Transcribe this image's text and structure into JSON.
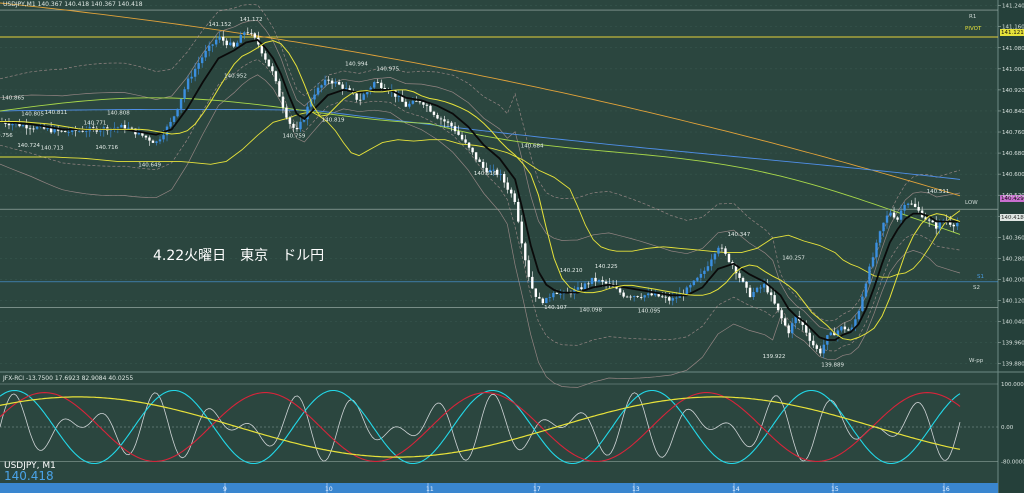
{
  "window": {
    "title": "USDJPY,M1 140.367 140.418 140.367 140.418",
    "caption": "4.22火曜日　東京　ドル円",
    "overlay_symbol": "USDJPY, M1",
    "overlay_price": "140.418"
  },
  "colors": {
    "background": "#2b463f",
    "grid": "#3b5a52",
    "candle_up": "#3b8fe0",
    "candle_down": "#ffffff",
    "ma_black": "#0a0a0a",
    "ma_yellow": "#e6e23a",
    "ma_green": "#a8d84a",
    "ma_blue": "#4f8fe8",
    "ma_orange": "#e2a33a",
    "bollinger": "#b79a9a",
    "osc_red": "#d8243a",
    "osc_cyan": "#22d8e8",
    "osc_white": "#cfd4d6",
    "osc_yellow": "#e8e23a"
  },
  "chart_data": {
    "type": "line",
    "symbol": "USDJPY",
    "timeframe": "M1",
    "ylim": [
      139.86,
      141.25
    ],
    "price_axis_ticks": [
      "141.240",
      "141.160",
      "141.080",
      "141.000",
      "140.920",
      "140.840",
      "140.760",
      "140.680",
      "140.600",
      "140.520",
      "140.440",
      "140.360",
      "140.280",
      "140.200",
      "140.120",
      "140.040",
      "139.960",
      "139.880"
    ],
    "x_date_labels": [
      "9",
      "10",
      "11",
      "17",
      "13",
      "14",
      "15",
      "16"
    ],
    "levels": [
      {
        "name": "R1",
        "value": 141.223
      },
      {
        "name": "PIVOT",
        "value": 141.121
      },
      {
        "name": "LOW",
        "value": 140.467
      },
      {
        "name": "S1",
        "value": 140.191
      },
      {
        "name": "S2",
        "value": 140.093
      }
    ],
    "level_tags": [
      "R1",
      "PIVOT",
      "141.121",
      "140.429",
      "140.418",
      "LOW",
      "S1",
      "S2",
      "W-pp"
    ],
    "price_labels": [
      {
        "text": "141.152",
        "x": 56,
        "y": 141.162
      },
      {
        "text": "141.172",
        "x": 64,
        "y": 141.182
      },
      {
        "text": "140.952",
        "x": 60,
        "y": 140.968
      },
      {
        "text": "140.994",
        "x": 91,
        "y": 141.012
      },
      {
        "text": "140.975",
        "x": 99,
        "y": 140.993
      },
      {
        "text": "140.865",
        "x": 3,
        "y": 140.883
      },
      {
        "text": "140.805",
        "x": 8,
        "y": 140.823
      },
      {
        "text": "140.811",
        "x": 14,
        "y": 140.829
      },
      {
        "text": "140.771",
        "x": 24,
        "y": 140.789
      },
      {
        "text": "140.808",
        "x": 30,
        "y": 140.826
      },
      {
        "text": "140.756",
        "x": 0,
        "y": 140.742
      },
      {
        "text": "140.724",
        "x": 7,
        "y": 140.704
      },
      {
        "text": "140.713",
        "x": 13,
        "y": 140.693
      },
      {
        "text": "140.716",
        "x": 27,
        "y": 140.696
      },
      {
        "text": "140.759",
        "x": 75,
        "y": 140.74
      },
      {
        "text": "140.819",
        "x": 85,
        "y": 140.8
      },
      {
        "text": "140.649",
        "x": 38,
        "y": 140.629
      },
      {
        "text": "140.684",
        "x": 136,
        "y": 140.702
      },
      {
        "text": "140.616",
        "x": 124,
        "y": 140.596
      },
      {
        "text": "140.210",
        "x": 146,
        "y": 140.228
      },
      {
        "text": "140.225",
        "x": 155,
        "y": 140.243
      },
      {
        "text": "140.107",
        "x": 142,
        "y": 140.087
      },
      {
        "text": "140.098",
        "x": 151,
        "y": 140.078
      },
      {
        "text": "140.095",
        "x": 166,
        "y": 140.075
      },
      {
        "text": "140.347",
        "x": 189,
        "y": 140.365
      },
      {
        "text": "140.257",
        "x": 203,
        "y": 140.275
      },
      {
        "text": "139.922",
        "x": 198,
        "y": 139.902
      },
      {
        "text": "139.889",
        "x": 213,
        "y": 139.869
      },
      {
        "text": "140.511",
        "x": 240,
        "y": 140.529
      }
    ],
    "price": {
      "x": [
        0,
        8,
        16,
        24,
        32,
        40,
        44,
        48,
        52,
        56,
        60,
        63,
        66,
        68,
        70,
        72,
        74,
        76,
        78,
        80,
        84,
        88,
        92,
        96,
        100,
        104,
        108,
        112,
        116,
        120,
        124,
        128,
        132,
        134,
        136,
        138,
        140,
        142,
        144,
        148,
        152,
        156,
        160,
        164,
        168,
        172,
        176,
        180,
        184,
        188,
        192,
        196,
        200,
        202,
        204,
        206,
        208,
        210,
        212,
        214,
        216,
        218,
        220,
        222,
        224,
        226,
        228,
        230,
        232,
        234,
        236,
        238,
        240,
        242,
        244,
        246
      ],
      "close": [
        140.8,
        140.78,
        140.76,
        140.77,
        140.78,
        140.72,
        140.8,
        140.95,
        141.05,
        141.12,
        141.08,
        141.15,
        141.1,
        141.04,
        140.98,
        140.88,
        140.8,
        140.76,
        140.82,
        140.9,
        140.96,
        140.93,
        140.88,
        140.95,
        140.92,
        140.86,
        140.88,
        140.82,
        140.78,
        140.7,
        140.62,
        140.6,
        140.5,
        140.32,
        140.18,
        140.12,
        140.12,
        140.16,
        140.14,
        140.16,
        140.2,
        140.18,
        140.14,
        140.14,
        140.14,
        140.12,
        140.16,
        140.22,
        140.33,
        140.25,
        140.14,
        140.18,
        140.06,
        140.0,
        140.06,
        140.02,
        139.96,
        139.92,
        139.98,
        140.0,
        140.02,
        140.0,
        140.08,
        140.2,
        140.3,
        140.4,
        140.46,
        140.43,
        140.5,
        140.48,
        140.45,
        140.42,
        140.4,
        140.43,
        140.41,
        140.418
      ],
      "ma_short": [
        140.8,
        140.79,
        140.77,
        140.77,
        140.77,
        140.75,
        140.77,
        140.85,
        140.95,
        141.04,
        141.07,
        141.1,
        141.11,
        141.08,
        141.04,
        140.98,
        140.9,
        140.83,
        140.81,
        140.84,
        140.9,
        140.92,
        140.91,
        140.92,
        140.92,
        140.89,
        140.88,
        140.86,
        140.83,
        140.78,
        140.71,
        140.66,
        140.58,
        140.46,
        140.33,
        140.23,
        140.18,
        140.16,
        140.15,
        140.15,
        140.17,
        140.18,
        140.17,
        140.16,
        140.15,
        140.14,
        140.14,
        140.17,
        140.24,
        140.26,
        140.22,
        140.19,
        140.14,
        140.09,
        140.06,
        140.04,
        140.01,
        139.98,
        139.97,
        139.97,
        139.99,
        140.0,
        140.03,
        140.09,
        140.17,
        140.26,
        140.34,
        140.39,
        140.43,
        140.45,
        140.45,
        140.44,
        140.42,
        140.42,
        140.42,
        140.42
      ]
    },
    "oscillator": {
      "name": "JFX-RCI",
      "header_values": [
        "-13.7500",
        "17.6923",
        "82.9084",
        "40.0255"
      ],
      "ylim": [
        -100,
        100
      ],
      "ticks": [
        100.0,
        0.0,
        -80.0
      ],
      "tick_labels": [
        "100.0000",
        "0.00",
        "-80.0000"
      ]
    }
  }
}
